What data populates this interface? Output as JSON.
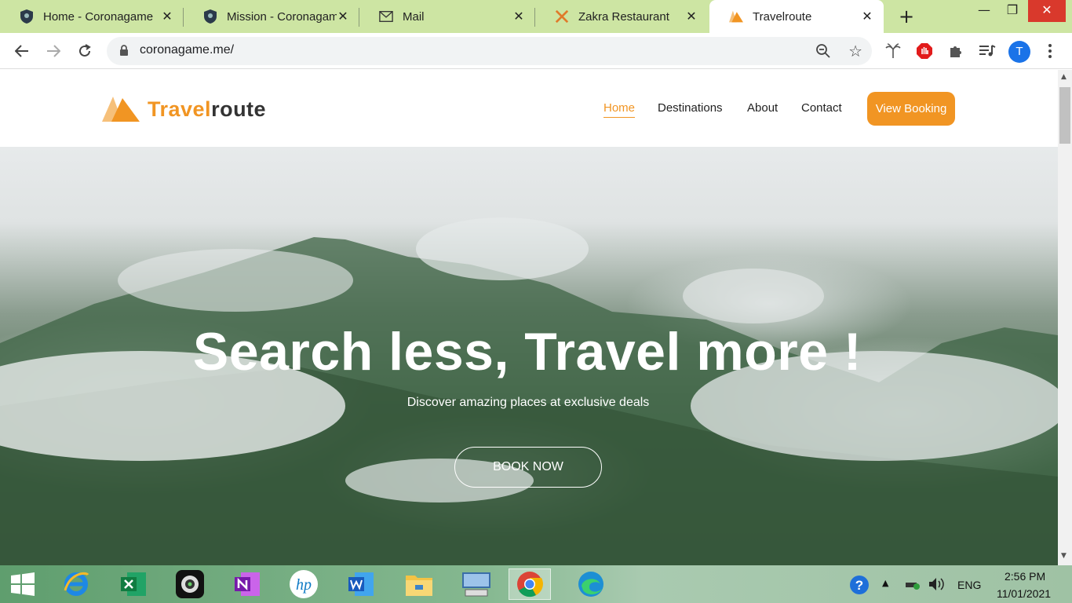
{
  "browser": {
    "tabs": [
      {
        "title": "Home - Coronagame",
        "icon": "shield-favicon"
      },
      {
        "title": "Mission - Coronagam",
        "icon": "shield-favicon"
      },
      {
        "title": "Mail",
        "icon": "mail-icon"
      },
      {
        "title": "Zakra Restaurant",
        "icon": "zakra-favicon"
      },
      {
        "title": "Travelroute",
        "icon": "travelroute-favicon",
        "active": true
      }
    ],
    "url": "coronagame.me/",
    "profile_initial": "T"
  },
  "site": {
    "logo": {
      "part1": "Travel",
      "part2": "route"
    },
    "nav": [
      {
        "label": "Home",
        "active": true
      },
      {
        "label": "Destinations"
      },
      {
        "label": "About"
      },
      {
        "label": "Contact"
      }
    ],
    "cta_label": "View Booking",
    "hero": {
      "title": "Search less, Travel more !",
      "subtitle": "Discover amazing places at exclusive deals",
      "button_label": "BOOK NOW"
    },
    "accent_color": "#f19523"
  },
  "taskbar": {
    "apps": [
      "windows-start-icon",
      "internet-explorer-icon",
      "excel-icon",
      "camera-app-icon",
      "onenote-icon",
      "hp-icon",
      "word-icon",
      "file-explorer-icon",
      "on-screen-keyboard-icon",
      "chrome-icon",
      "edge-icon"
    ],
    "tray": {
      "language": "ENG",
      "time": "2:56 PM",
      "date": "11/01/2021"
    }
  }
}
